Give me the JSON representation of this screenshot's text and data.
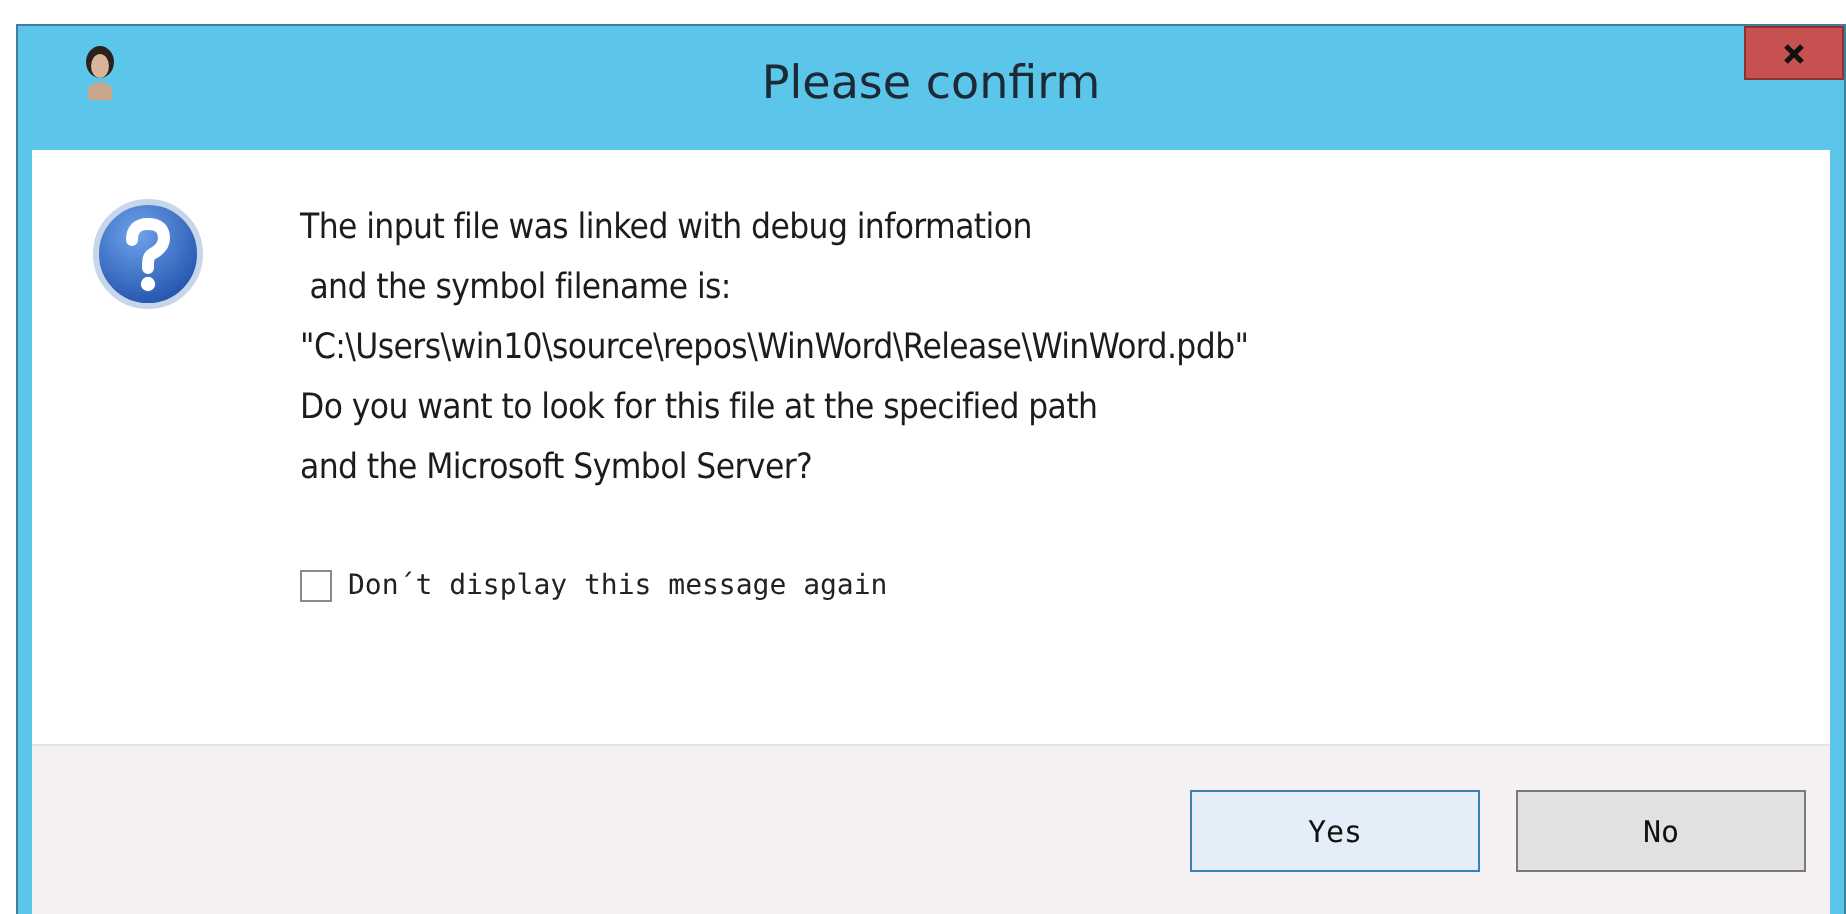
{
  "window": {
    "title": "Please confirm"
  },
  "message": "The input file was linked with debug information\n and the symbol filename is:\n\"C:\\Users\\win10\\source\\repos\\WinWord\\Release\\WinWord.pdb\"\nDo you want to look for this file at the specified path\nand the Microsoft Symbol Server?",
  "checkbox": {
    "label": "Don´t display this message again",
    "checked": false
  },
  "buttons": [
    {
      "label": "Yes",
      "default": true
    },
    {
      "label": "No",
      "default": false
    }
  ]
}
